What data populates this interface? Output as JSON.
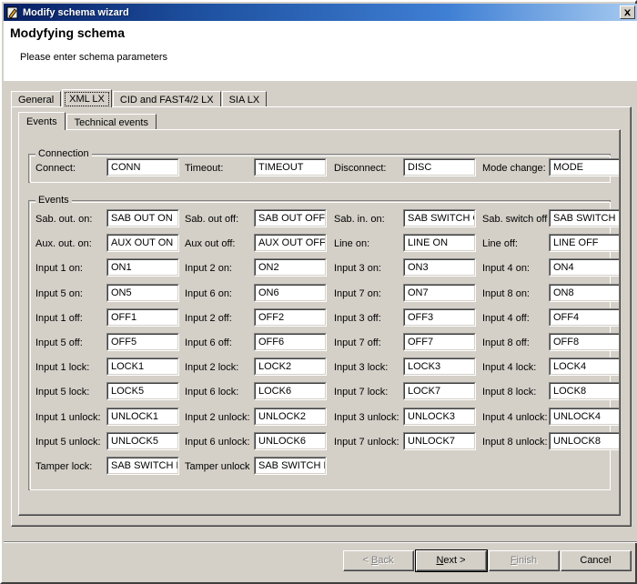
{
  "window": {
    "title": "Modify schema wizard",
    "icon": "pencil-document-icon",
    "close_label": "close-icon",
    "titlebar_color": "#0a246a",
    "face_color": "#d4d0c8"
  },
  "header": {
    "title": "Modyfying schema",
    "subtitle": "Please enter schema parameters"
  },
  "tabs": [
    {
      "label": "General",
      "selected": false
    },
    {
      "label": "XML LX",
      "selected": true
    },
    {
      "label": "CID and FAST4/2 LX",
      "selected": false
    },
    {
      "label": "SIA LX",
      "selected": false
    }
  ],
  "subtabs": [
    {
      "label": "Events",
      "selected": true
    },
    {
      "label": "Technical events",
      "selected": false
    }
  ],
  "groups": {
    "connection": {
      "legend": "Connection",
      "fields": [
        {
          "label": "Connect:",
          "value": "CONN"
        },
        {
          "label": "Timeout:",
          "value": "TIMEOUT"
        },
        {
          "label": "Disconnect:",
          "value": "DISC"
        },
        {
          "label": "Mode change:",
          "value": "MODE"
        }
      ]
    },
    "events": {
      "legend": "Events",
      "rows": [
        [
          {
            "label": "Sab. out. on:",
            "value": "SAB OUT ON"
          },
          {
            "label": "Sab. out off:",
            "value": "SAB OUT OFF"
          },
          {
            "label": "Sab. in. on:",
            "value": "SAB SWITCH C"
          },
          {
            "label": "Sab. switch off",
            "value": "SAB SWITCH ("
          }
        ],
        [
          {
            "label": "Aux. out. on:",
            "value": "AUX OUT ON"
          },
          {
            "label": "Aux out off:",
            "value": "AUX OUT OFF"
          },
          {
            "label": "Line on:",
            "value": "LINE ON"
          },
          {
            "label": "Line off:",
            "value": "LINE OFF"
          }
        ],
        [
          {
            "label": "Input 1 on:",
            "value": "ON1"
          },
          {
            "label": "Input 2 on:",
            "value": "ON2"
          },
          {
            "label": "Input 3 on:",
            "value": "ON3"
          },
          {
            "label": "Input 4 on:",
            "value": "ON4"
          }
        ],
        [
          {
            "label": "Input 5 on:",
            "value": "ON5"
          },
          {
            "label": "Input 6 on:",
            "value": "ON6"
          },
          {
            "label": "Input 7 on:",
            "value": "ON7"
          },
          {
            "label": "Input 8 on:",
            "value": "ON8"
          }
        ],
        [
          {
            "label": "Input 1 off:",
            "value": "OFF1"
          },
          {
            "label": "Input 2 off:",
            "value": "OFF2"
          },
          {
            "label": "Input 3 off:",
            "value": "OFF3"
          },
          {
            "label": "Input 4 off:",
            "value": "OFF4"
          }
        ],
        [
          {
            "label": "Input 5 off:",
            "value": "OFF5"
          },
          {
            "label": "Input 6 off:",
            "value": "OFF6"
          },
          {
            "label": "Input 7 off:",
            "value": "OFF7"
          },
          {
            "label": "Input 8 off:",
            "value": "OFF8"
          }
        ],
        [
          {
            "label": "Input 1 lock:",
            "value": "LOCK1"
          },
          {
            "label": "Input 2 lock:",
            "value": "LOCK2"
          },
          {
            "label": "Input 3 lock:",
            "value": "LOCK3"
          },
          {
            "label": "Input 4 lock:",
            "value": "LOCK4"
          }
        ],
        [
          {
            "label": "Input 5 lock:",
            "value": "LOCK5"
          },
          {
            "label": "Input 6 lock:",
            "value": "LOCK6"
          },
          {
            "label": "Input 7 lock:",
            "value": "LOCK7"
          },
          {
            "label": "Input 8 lock:",
            "value": "LOCK8"
          }
        ],
        [
          {
            "label": "Input 1 unlock:",
            "value": "UNLOCK1"
          },
          {
            "label": "Input 2 unlock:",
            "value": "UNLOCK2"
          },
          {
            "label": "Input 3 unlock:",
            "value": "UNLOCK3"
          },
          {
            "label": "Input 4 unlock:",
            "value": "UNLOCK4"
          }
        ],
        [
          {
            "label": "Input 5 unlock:",
            "value": "UNLOCK5"
          },
          {
            "label": "Input 6 unlock:",
            "value": "UNLOCK6"
          },
          {
            "label": "Input 7 unlock:",
            "value": "UNLOCK7"
          },
          {
            "label": "Input 8 unlock:",
            "value": "UNLOCK8"
          }
        ],
        [
          {
            "label": "Tamper lock:",
            "value": "SAB SWITCH L"
          },
          {
            "label": "Tamper unlock",
            "value": "SAB SWITCH L"
          }
        ]
      ]
    }
  },
  "buttons": [
    {
      "label_pre": "< ",
      "label_accel": "B",
      "label_post": "ack",
      "name": "back-button",
      "disabled": true,
      "default": false
    },
    {
      "label_pre": "",
      "label_accel": "N",
      "label_post": "ext >",
      "name": "next-button",
      "disabled": false,
      "default": true
    },
    {
      "label_pre": "",
      "label_accel": "F",
      "label_post": "inish",
      "name": "finish-button",
      "disabled": true,
      "default": false
    },
    {
      "label_pre": "",
      "label_accel": "",
      "label_post": "Cancel",
      "name": "cancel-button",
      "disabled": false,
      "default": false
    }
  ]
}
